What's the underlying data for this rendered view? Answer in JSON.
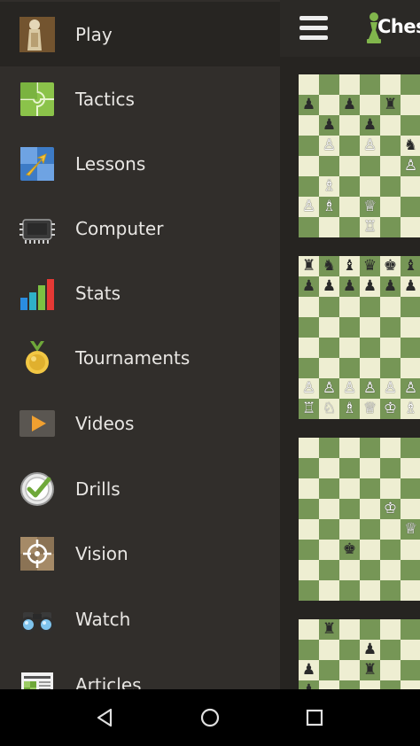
{
  "drawer": {
    "items": [
      {
        "label": "Play",
        "icon": "pawn-figure-icon",
        "active": true
      },
      {
        "label": "Tactics",
        "icon": "puzzle-icon"
      },
      {
        "label": "Lessons",
        "icon": "lessons-arrow-icon"
      },
      {
        "label": "Computer",
        "icon": "computer-chip-icon"
      },
      {
        "label": "Stats",
        "icon": "bar-chart-icon"
      },
      {
        "label": "Tournaments",
        "icon": "medal-icon"
      },
      {
        "label": "Videos",
        "icon": "play-video-icon"
      },
      {
        "label": "Drills",
        "icon": "checkmark-circle-icon"
      },
      {
        "label": "Vision",
        "icon": "crosshair-icon"
      },
      {
        "label": "Watch",
        "icon": "binoculars-icon"
      },
      {
        "label": "Articles",
        "icon": "newspaper-icon"
      }
    ]
  },
  "header": {
    "logo_text": "Ches",
    "menu_icon": "hamburger-icon"
  },
  "boards": [
    {
      "rows": [
        [
          "",
          "",
          "",
          "",
          "",
          "",
          ""
        ],
        [
          "b:♟",
          "",
          "b:♟",
          "",
          "b:♜",
          "",
          ""
        ],
        [
          "",
          "b:♟",
          "",
          "b:♟",
          "",
          "",
          ""
        ],
        [
          "",
          "w:♙",
          "",
          "w:♙",
          "",
          "b:♞",
          ""
        ],
        [
          "",
          "",
          "",
          "",
          "",
          "w:♙",
          ""
        ],
        [
          "",
          "w:♗",
          "",
          "",
          "",
          "",
          ""
        ],
        [
          "w:♙",
          "w:♗",
          "",
          "w:♕",
          "",
          "",
          ""
        ],
        [
          "",
          "",
          "",
          "w:♖",
          "",
          "",
          ""
        ]
      ]
    },
    {
      "rows": [
        [
          "b:♜",
          "b:♞",
          "b:♝",
          "b:♛",
          "b:♚",
          "b:♝",
          ""
        ],
        [
          "b:♟",
          "b:♟",
          "b:♟",
          "b:♟",
          "b:♟",
          "b:♟",
          ""
        ],
        [
          "",
          "",
          "",
          "",
          "",
          "",
          ""
        ],
        [
          "",
          "",
          "",
          "",
          "",
          "",
          ""
        ],
        [
          "",
          "",
          "",
          "",
          "",
          "",
          ""
        ],
        [
          "",
          "",
          "",
          "",
          "",
          "",
          ""
        ],
        [
          "w:♙",
          "w:♙",
          "w:♙",
          "w:♙",
          "w:♙",
          "w:♙",
          ""
        ],
        [
          "w:♖",
          "w:♘",
          "w:♗",
          "w:♕",
          "w:♔",
          "w:♗",
          ""
        ]
      ]
    },
    {
      "rows": [
        [
          "",
          "",
          "",
          "",
          "",
          "",
          ""
        ],
        [
          "",
          "",
          "",
          "",
          "",
          "",
          ""
        ],
        [
          "",
          "",
          "",
          "",
          "",
          "",
          ""
        ],
        [
          "",
          "",
          "",
          "",
          "w:♔",
          "",
          ""
        ],
        [
          "",
          "",
          "",
          "",
          "",
          "w:♕",
          ""
        ],
        [
          "",
          "",
          "b:♚",
          "",
          "",
          "",
          ""
        ],
        [
          "",
          "",
          "",
          "",
          "",
          "",
          ""
        ],
        [
          "",
          "",
          "",
          "",
          "",
          "",
          ""
        ]
      ]
    },
    {
      "rows": [
        [
          "",
          "b:♜",
          "",
          "",
          "",
          "",
          ""
        ],
        [
          "",
          "",
          "",
          "b:♟",
          "",
          "",
          ""
        ],
        [
          "b:♟",
          "",
          "",
          "b:♜",
          "",
          "",
          ""
        ],
        [
          "b:♟",
          "",
          "",
          "",
          "",
          "",
          ""
        ]
      ]
    }
  ],
  "navbar": {
    "back_icon": "back-triangle-icon",
    "home_icon": "home-circle-icon",
    "recents_icon": "recents-square-icon"
  },
  "colors": {
    "drawer_bg": "#312e2b",
    "active_bg": "#272522",
    "board_light": "#eeeed2",
    "board_dark": "#769656",
    "brand_green": "#81b64c"
  }
}
